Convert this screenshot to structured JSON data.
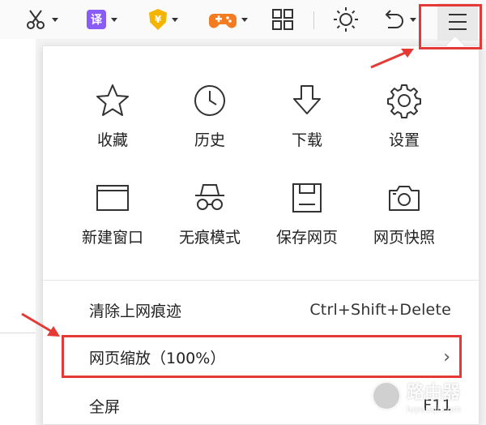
{
  "toolbar": {
    "translate_badge": "译",
    "shield_badge": "¥",
    "icons": [
      "scissors-icon",
      "translate-icon",
      "shield-icon",
      "gamepad-icon",
      "grid-icon",
      "brightness-icon",
      "undo-icon",
      "hamburger-menu-icon"
    ]
  },
  "menu": {
    "grid": [
      {
        "label": "收藏",
        "icon": "star-icon"
      },
      {
        "label": "历史",
        "icon": "clock-icon"
      },
      {
        "label": "下载",
        "icon": "download-icon"
      },
      {
        "label": "设置",
        "icon": "gear-icon"
      },
      {
        "label": "新建窗口",
        "icon": "window-icon"
      },
      {
        "label": "无痕模式",
        "icon": "incognito-icon"
      },
      {
        "label": "保存网页",
        "icon": "save-icon"
      },
      {
        "label": "网页快照",
        "icon": "camera-icon"
      }
    ],
    "clear_history": {
      "label": "清除上网痕迹",
      "shortcut": "Ctrl+Shift+Delete"
    },
    "zoom": {
      "label": "网页缩放（100%）",
      "chevron": "›"
    },
    "fullscreen": {
      "label": "全屏",
      "shortcut": "F11"
    }
  },
  "watermark": {
    "title": "路由器",
    "subtitle": "luyouqi.com"
  },
  "colors": {
    "highlight": "#e53935",
    "accent_purple": "#8a5cf6",
    "accent_orange": "#f47b20",
    "accent_yellow": "#f4b400"
  }
}
